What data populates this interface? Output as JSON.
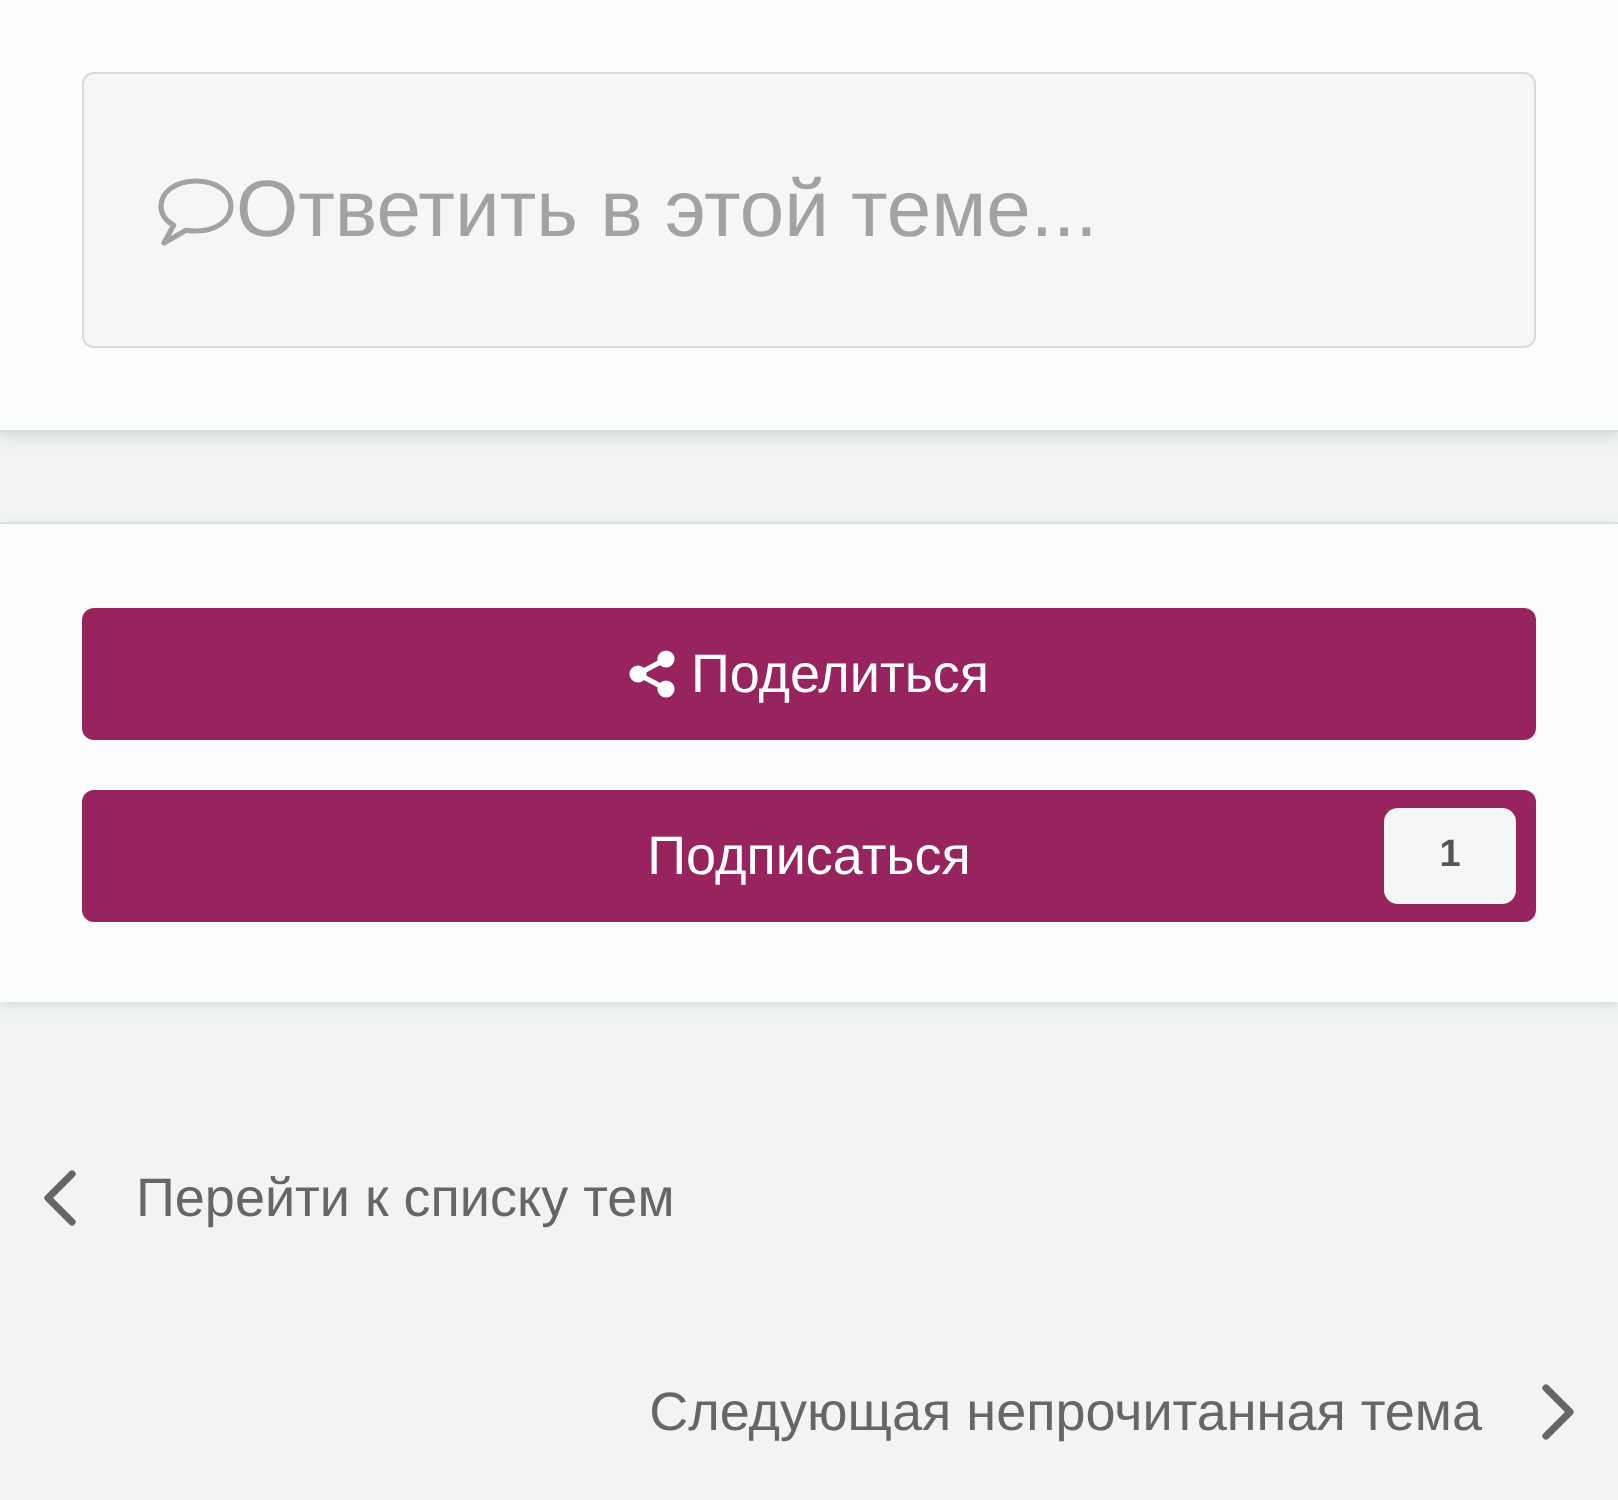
{
  "reply_box": {
    "placeholder": "Ответить в этой теме..."
  },
  "buttons": [
    {
      "kind": "share",
      "label": "Поделиться"
    },
    {
      "kind": "follow",
      "label": "Подписаться",
      "count": "1"
    }
  ],
  "navigation": [
    {
      "kind": "previous",
      "label": "Перейти к списку тем"
    },
    {
      "kind": "next",
      "label": "Следующая непрочитанная тема"
    }
  ]
}
